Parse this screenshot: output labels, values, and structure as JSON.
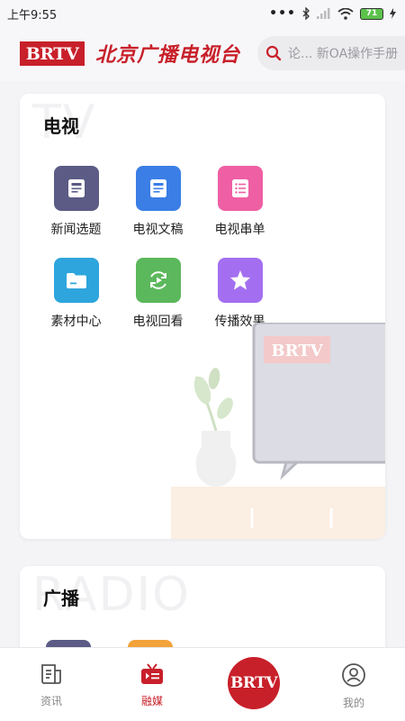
{
  "status_bar": {
    "time": "上午9:55",
    "dots": "•••",
    "battery": "71"
  },
  "header": {
    "logo_text": "BRTV",
    "station_name": "北京广播电视台",
    "search_placeholder": "论...  新OA操作手册"
  },
  "tv_section": {
    "watermark": "TV",
    "title": "电视",
    "tiles": [
      {
        "label": "新闻选题",
        "icon": "document-icon",
        "color": "#5b5b86"
      },
      {
        "label": "电视文稿",
        "icon": "document-icon",
        "color": "#3a7ee6"
      },
      {
        "label": "电视串单",
        "icon": "list-icon",
        "color": "#ef5fa4"
      },
      {
        "label": "素材中心",
        "icon": "folder-icon",
        "color": "#2ea5dd"
      },
      {
        "label": "电视回看",
        "icon": "replay-icon",
        "color": "#5cb85c"
      },
      {
        "label": "传播效果",
        "icon": "star-icon",
        "color": "#a36ff0"
      }
    ],
    "illustration_logo": "BRTV"
  },
  "radio_section": {
    "watermark": "RADIO",
    "title": "广播",
    "icon_colors": [
      "#5b5b86",
      "#f2a33a"
    ]
  },
  "bottom_nav": {
    "items": [
      {
        "label": "资讯",
        "icon": "news-icon",
        "active": false
      },
      {
        "label": "融媒",
        "icon": "media-icon",
        "active": true
      },
      {
        "label": "BRTV",
        "icon": "brtv-logo-icon",
        "active": false
      },
      {
        "label": "我的",
        "icon": "profile-icon",
        "active": false
      }
    ]
  },
  "colors": {
    "brand_red": "#c8202a",
    "background": "#f4f4f6"
  }
}
